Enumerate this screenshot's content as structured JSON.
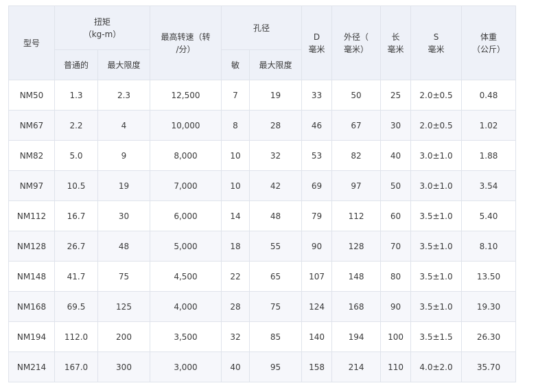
{
  "table": {
    "headers": {
      "model": "型号",
      "torque_line1": "扭矩",
      "torque_line2": "（kg-m）",
      "max_speed_line1": "最高转速（转",
      "max_speed_line2": "/分）",
      "bore": "孔径",
      "d_line1": "D",
      "d_line2": "毫米",
      "outer_line1": "外径（",
      "outer_line2": "毫米）",
      "length_line1": "长",
      "length_line2": "毫米",
      "s_line1": "S",
      "s_line2": "毫米",
      "weight_line1": "体重",
      "weight_line2": "（公斤）",
      "torque_normal": "普通的",
      "torque_max": "最大限度",
      "bore_min": "敏",
      "bore_max": "最大限度"
    },
    "rows": [
      [
        "NM50",
        "1.3",
        "2.3",
        "12,500",
        "7",
        "19",
        "33",
        "50",
        "25",
        "2.0±0.5",
        "0.48"
      ],
      [
        "NM67",
        "2.2",
        "4",
        "10,000",
        "8",
        "28",
        "46",
        "67",
        "30",
        "2.0±0.5",
        "1.02"
      ],
      [
        "NM82",
        "5.0",
        "9",
        "8,000",
        "10",
        "32",
        "53",
        "82",
        "40",
        "3.0±1.0",
        "1.88"
      ],
      [
        "NM97",
        "10.5",
        "19",
        "7,000",
        "10",
        "42",
        "69",
        "97",
        "50",
        "3.0±1.0",
        "3.54"
      ],
      [
        "NM112",
        "16.7",
        "30",
        "6,000",
        "14",
        "48",
        "79",
        "112",
        "60",
        "3.5±1.0",
        "5.40"
      ],
      [
        "NM128",
        "26.7",
        "48",
        "5,000",
        "18",
        "55",
        "90",
        "128",
        "70",
        "3.5±1.0",
        "8.10"
      ],
      [
        "NM148",
        "41.7",
        "75",
        "4,500",
        "22",
        "65",
        "107",
        "148",
        "80",
        "3.5±1.0",
        "13.50"
      ],
      [
        "NM168",
        "69.5",
        "125",
        "4,000",
        "28",
        "75",
        "124",
        "168",
        "90",
        "3.5±1.0",
        "19.30"
      ],
      [
        "NM194",
        "112.0",
        "200",
        "3,500",
        "32",
        "85",
        "140",
        "194",
        "100",
        "3.5±1.5",
        "26.30"
      ],
      [
        "NM214",
        "167.0",
        "300",
        "3,000",
        "40",
        "95",
        "158",
        "214",
        "110",
        "4.0±2.0",
        "35.70"
      ]
    ]
  }
}
